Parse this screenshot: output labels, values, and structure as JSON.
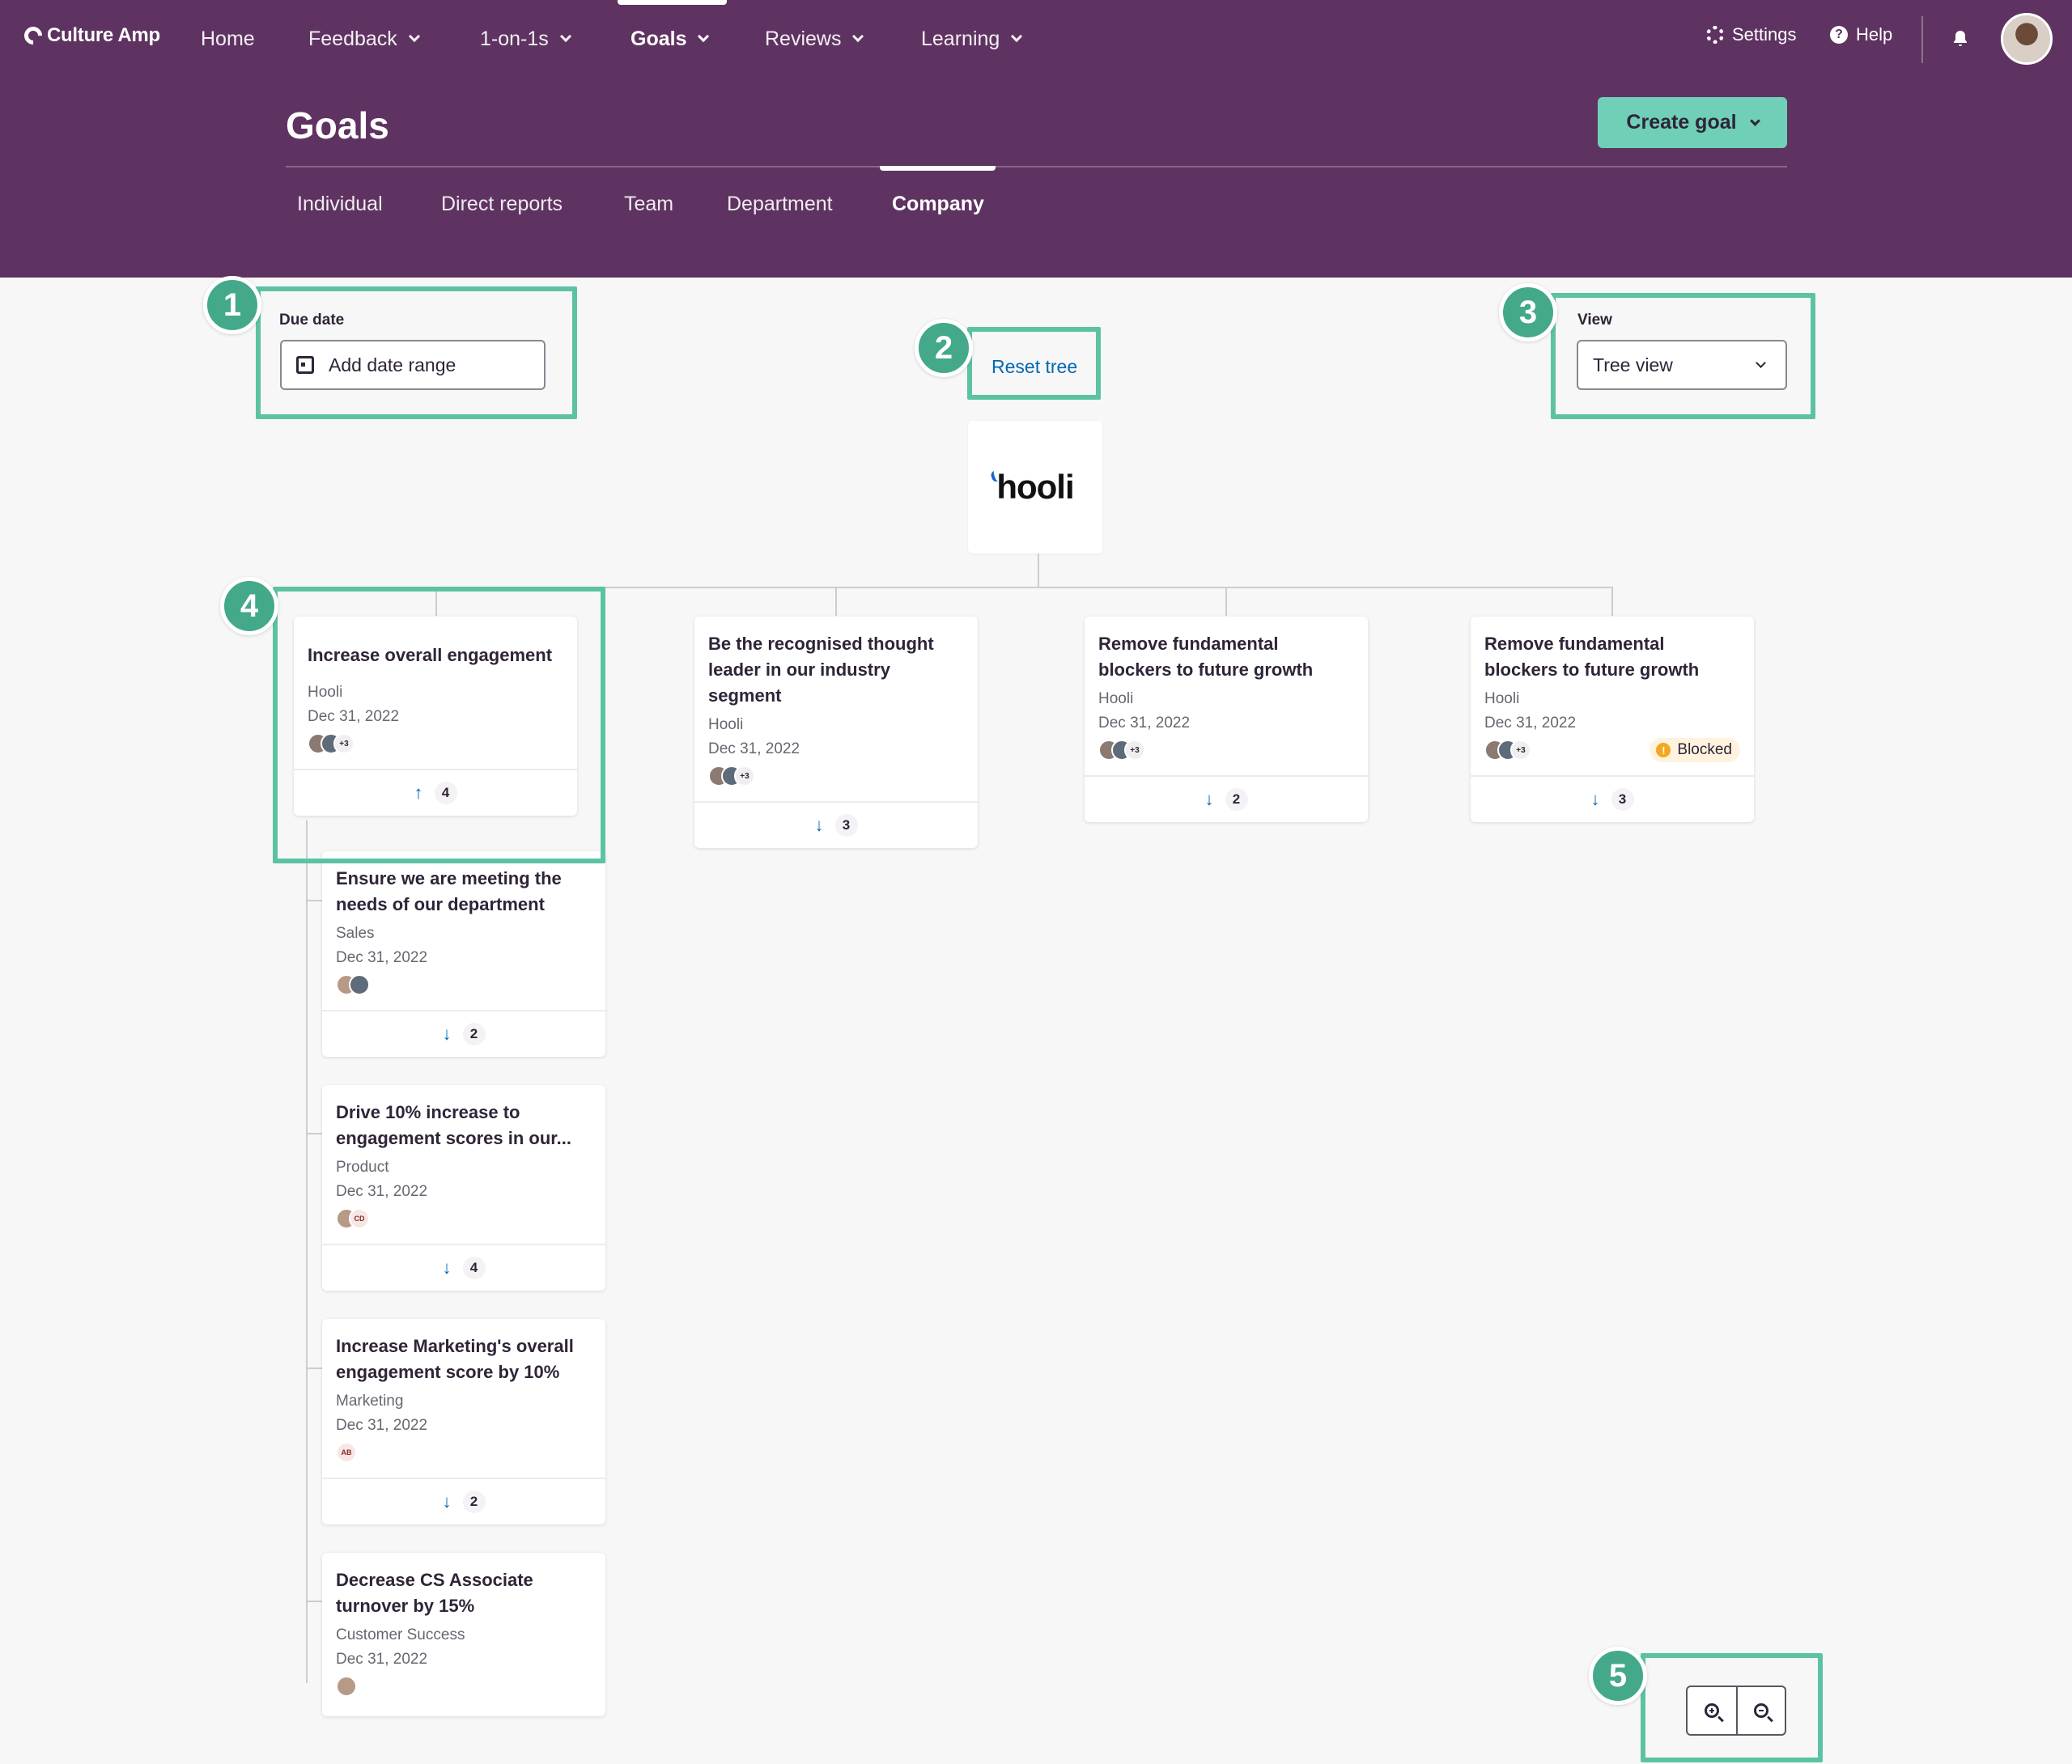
{
  "nav": {
    "logo": "Culture Amp",
    "items": [
      "Home",
      "Feedback",
      "1-on-1s",
      "Goals",
      "Reviews",
      "Learning"
    ],
    "settings": "Settings",
    "help": "Help"
  },
  "page": {
    "title": "Goals",
    "create_goal": "Create goal",
    "tabs": [
      "Individual",
      "Direct reports",
      "Team",
      "Department",
      "Company"
    ],
    "active_tab": "Company"
  },
  "controls": {
    "due_date_label": "Due date",
    "due_date_placeholder": "Add date range",
    "reset_tree": "Reset tree",
    "view_label": "View",
    "view_value": "Tree view"
  },
  "company": {
    "name": "hooli"
  },
  "top_goals": [
    {
      "title": "Increase overall engagement",
      "dept": "Hooli",
      "date": "Dec 31, 2022",
      "avatars_more": "+3",
      "direction": "up",
      "count": "4",
      "status": ""
    },
    {
      "title": "Be the recognised thought leader in our industry segment",
      "dept": "Hooli",
      "date": "Dec 31, 2022",
      "avatars_more": "+3",
      "direction": "down",
      "count": "3",
      "status": ""
    },
    {
      "title": "Remove fundamental blockers to future growth",
      "dept": "Hooli",
      "date": "Dec 31, 2022",
      "avatars_more": "+3",
      "direction": "down",
      "count": "2",
      "status": ""
    },
    {
      "title": "Remove fundamental blockers to future growth",
      "dept": "Hooli",
      "date": "Dec 31, 2022",
      "avatars_more": "+3",
      "direction": "down",
      "count": "3",
      "status": "Blocked"
    }
  ],
  "child_goals": [
    {
      "title": "Ensure we are meeting the needs of our department",
      "dept": "Sales",
      "date": "Dec 31, 2022",
      "count": "2"
    },
    {
      "title": "Drive 10% increase to engagement scores in our...",
      "dept": "Product",
      "date": "Dec 31, 2022",
      "initials": "CD",
      "count": "4"
    },
    {
      "title": "Increase Marketing's overall engagement score by 10%",
      "dept": "Marketing",
      "date": "Dec 31, 2022",
      "initials": "AB",
      "count": "2"
    },
    {
      "title": "Decrease CS Associate turnover by 15%",
      "dept": "Customer Success",
      "date": "Dec 31, 2022"
    }
  ],
  "annotations": [
    "1",
    "2",
    "3",
    "4",
    "5"
  ],
  "colors": {
    "header": "#5f3361",
    "accent": "#6fcfb7",
    "highlight": "#5cc2a3",
    "badge": "#43a98a",
    "link": "#0168b3"
  }
}
